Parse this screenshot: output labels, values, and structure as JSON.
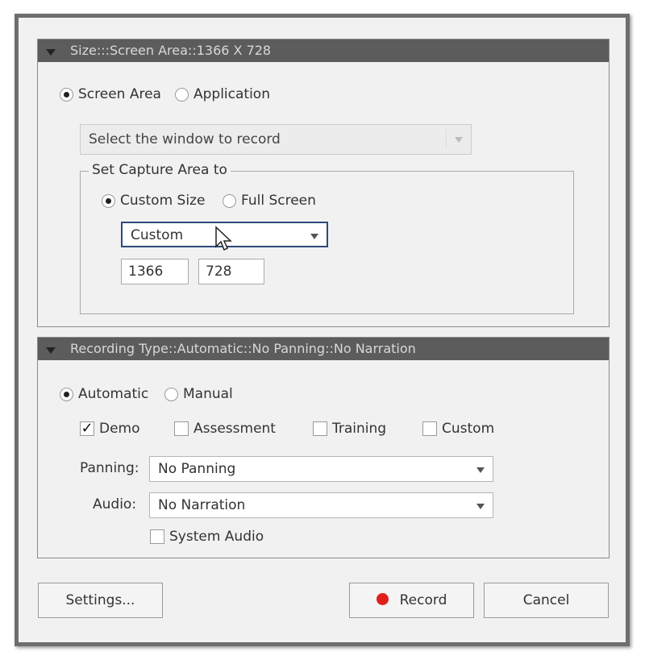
{
  "size_panel": {
    "header": "Size:::Screen Area::1366 X 728",
    "radio_screen": "Screen Area",
    "radio_app": "Application",
    "window_select_placeholder": "Select the window to record",
    "capture_group": {
      "legend": "Set Capture Area to",
      "radio_custom": "Custom Size",
      "radio_full": "Full Screen",
      "size_select": "Custom",
      "width": "1366",
      "height": "728"
    }
  },
  "recording_panel": {
    "header": "Recording Type::Automatic::No Panning::No Narration",
    "radio_auto": "Automatic",
    "radio_manual": "Manual",
    "modes": [
      {
        "label": "Demo",
        "checked": true
      },
      {
        "label": "Assessment",
        "checked": false
      },
      {
        "label": "Training",
        "checked": false
      },
      {
        "label": "Custom",
        "checked": false
      }
    ],
    "panning_label": "Panning:",
    "panning_value": "No Panning",
    "audio_label": "Audio:",
    "audio_value": "No Narration",
    "system_audio": "System Audio"
  },
  "buttons": {
    "settings": "Settings...",
    "record": "Record",
    "cancel": "Cancel"
  },
  "colors": {
    "header": "#5c5c5c",
    "record_dot": "#e0201c",
    "focus_border": "#2c4a7a"
  }
}
